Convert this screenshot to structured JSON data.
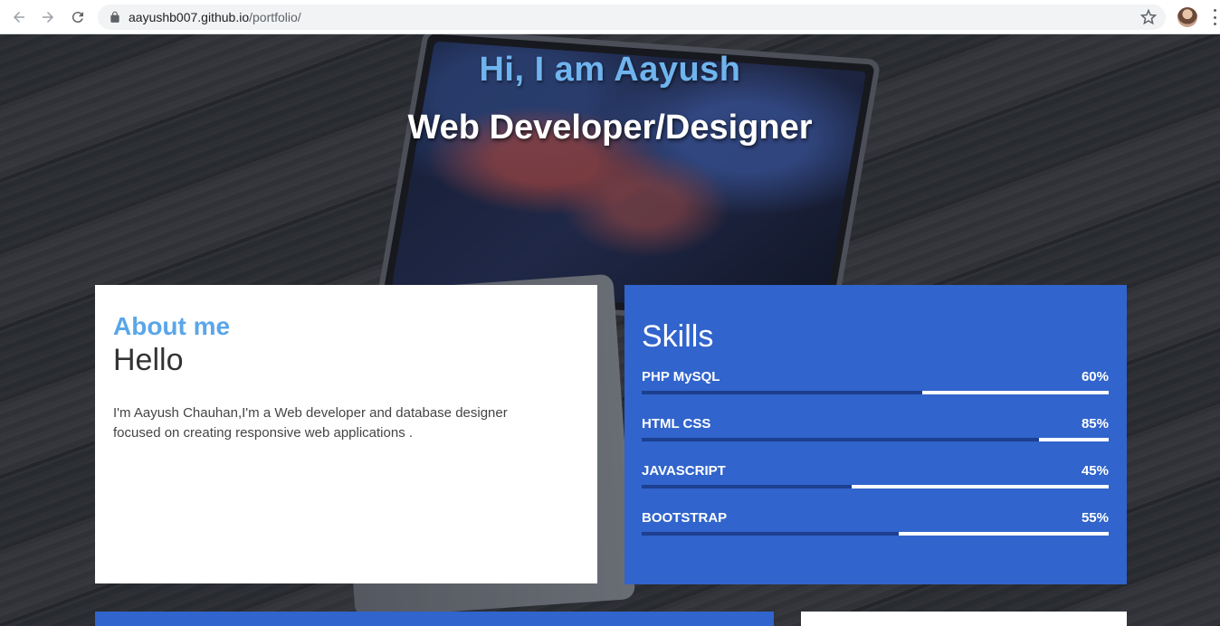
{
  "browser": {
    "url_host": "aayushb007.github.io",
    "url_path": "/portfolio/"
  },
  "hero": {
    "greeting": "Hi, I am Aayush",
    "role": "Web Developer/Designer"
  },
  "about": {
    "heading": "About me",
    "subheading": "Hello",
    "body": "I'm Aayush Chauhan,I'm a Web developer and database designer focused on creating responsive web applications ."
  },
  "skills": {
    "heading": "Skills",
    "items": [
      {
        "name": "PHP MySQL",
        "percent_label": "60%",
        "level": 0.6
      },
      {
        "name": "HTML CSS",
        "percent_label": "85%",
        "level": 0.85
      },
      {
        "name": "JAVASCRIPT",
        "percent_label": "45%",
        "level": 0.45
      },
      {
        "name": "BOOTSTRAP",
        "percent_label": "55%",
        "level": 0.55
      }
    ]
  },
  "colors": {
    "accent_blue": "#3164cc",
    "heading_blue": "#5aa6e8",
    "bar_fill": "#1d3f8f"
  }
}
